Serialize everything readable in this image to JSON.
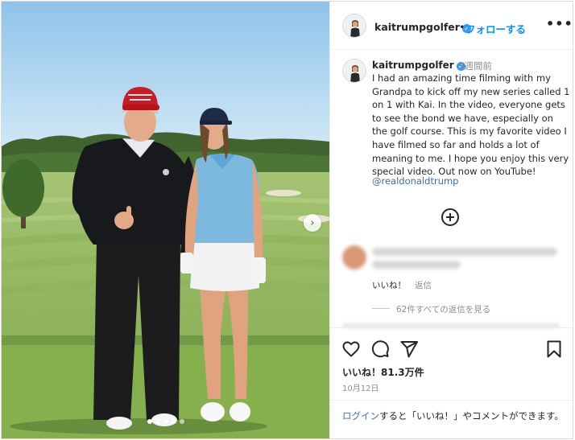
{
  "post": {
    "username": "kaitrumpgolfer",
    "verified_mark": "✓",
    "separator": "•",
    "follow_label": "フォローする",
    "more_glyph": "•••",
    "caption": {
      "username": "kaitrumpgolfer",
      "time": "3週間前",
      "text": "I had an amazing time filming with my Grandpa to kick off my new series called 1 on 1 with Kai. In the video, everyone gets to see the bond we have, especially on the golf course. This is my favorite video I have filmed so far and holds a lot of meaning to me. I hope you enjoy this very special video. Out now on YouTube!",
      "mention": "@realdonaldtrump"
    },
    "comment": {
      "likes_label": "いいね！",
      "reply_label": "返信",
      "view_replies": "62件すべての返信を見る"
    },
    "likes": "いいね！81.3万件",
    "date": "10月12日",
    "login": {
      "link": "ログイン",
      "rest": "すると「いいね！」やコメントができます。"
    },
    "carousel": {
      "slides": 5,
      "active_index": 0,
      "next_glyph": "›"
    }
  },
  "icons": {
    "like": "heart-icon",
    "comment": "comment-icon",
    "share": "send-icon",
    "save": "bookmark-icon",
    "add_comment": "plus-circle-icon"
  },
  "colors": {
    "link": "#3b6ea8",
    "follow": "#0095f6",
    "verified": "#3897f0",
    "muted": "#8e8e8e",
    "text": "#262626"
  }
}
